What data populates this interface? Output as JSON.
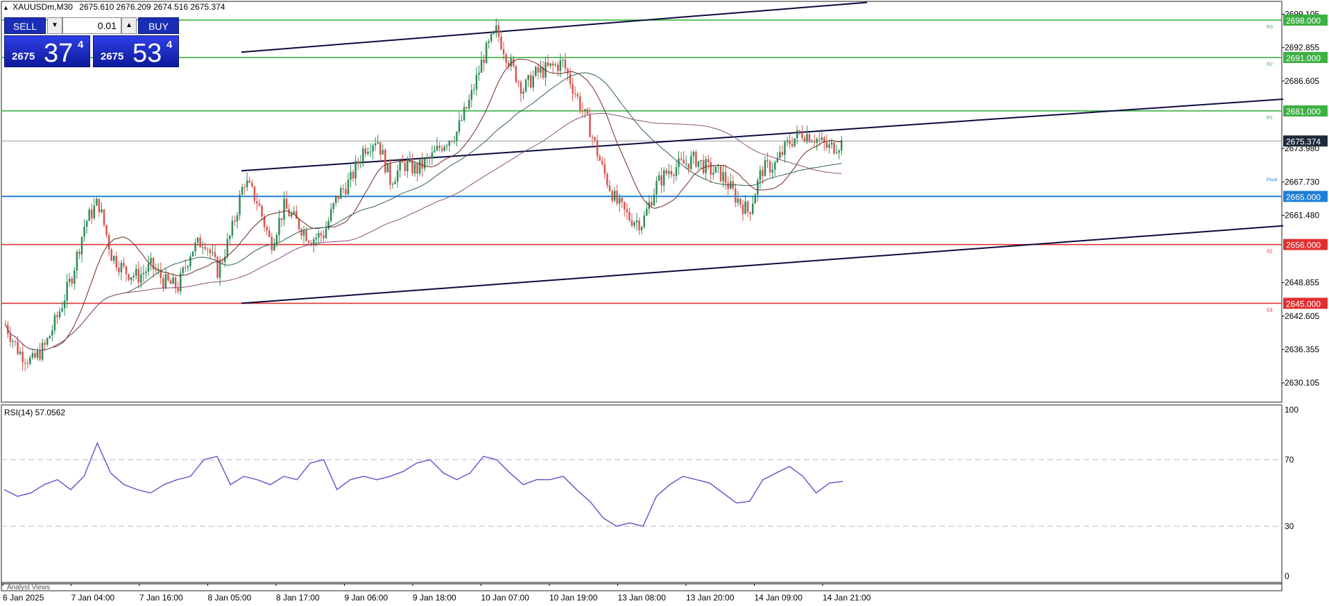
{
  "header": {
    "symbol": "XAUUSDm,M30",
    "ohlc": "2675.610 2676.209 2674.516 2675.374"
  },
  "trade_panel": {
    "sell_label": "SELL",
    "buy_label": "BUY",
    "lot": "0.01",
    "sell_price_small": "2675",
    "sell_price_big": "37",
    "sell_price_sup": "4",
    "buy_price_small": "2675",
    "buy_price_big": "53",
    "buy_price_sup": "4"
  },
  "colors": {
    "bull": "#2e8b57",
    "bear": "#d9534f",
    "resistance": "#3cb043",
    "support": "#e03030",
    "pivot": "#1e7fd8",
    "trendline": "#0a0a40",
    "rsi": "#6a5acd",
    "ma_fast": "#6b2a1a",
    "ma_mid": "#2f5f4f",
    "ma_slow": "#8b4d7a"
  },
  "chart_data": [
    {
      "type": "candlestick",
      "symbol": "XAUUSDm",
      "timeframe": "M30",
      "ylim": [
        2626.5,
        2701.5
      ],
      "yticks": [
        "2699.105",
        "2692.855",
        "2686.605",
        "2673.980",
        "2667.730",
        "2661.480",
        "2648.855",
        "2642.605",
        "2636.355",
        "2630.105"
      ],
      "current_price": "2675.374",
      "close_series": [
        2641,
        2636,
        2634,
        2637,
        2643,
        2650,
        2660,
        2664,
        2654,
        2651,
        2650,
        2652,
        2649,
        2648,
        2655,
        2657,
        2651,
        2658,
        2668,
        2664,
        2656,
        2663,
        2660,
        2657,
        2658,
        2665,
        2668,
        2674,
        2676,
        2668,
        2671,
        2670,
        2672,
        2675,
        2677,
        2683,
        2691,
        2696,
        2690,
        2685,
        2688,
        2689,
        2690,
        2684,
        2678,
        2670,
        2664,
        2661,
        2660,
        2667,
        2670,
        2671,
        2672,
        2670,
        2669,
        2665,
        2662,
        2670,
        2671,
        2675,
        2677,
        2676,
        2674,
        2675
      ],
      "levels": [
        {
          "label": "2698.000",
          "value": 2698.0,
          "tag": "R3",
          "kind": "resistance"
        },
        {
          "label": "2691.000",
          "value": 2691.0,
          "tag": "R2",
          "kind": "resistance"
        },
        {
          "label": "2681.000",
          "value": 2681.0,
          "tag": "R1",
          "kind": "resistance"
        },
        {
          "label": "2665.000",
          "value": 2665.0,
          "tag": "Pivot",
          "kind": "pivot"
        },
        {
          "label": "2656.000",
          "value": 2656.0,
          "tag": "S2",
          "kind": "support"
        },
        {
          "label": "2645.000",
          "value": 2645.0,
          "tag": "S3",
          "kind": "support"
        }
      ],
      "xticks": [
        "6 Jan 2025",
        "7 Jan 04:00",
        "7 Jan 16:00",
        "8 Jan 05:00",
        "8 Jan 17:00",
        "9 Jan 06:00",
        "9 Jan 18:00",
        "10 Jan 07:00",
        "10 Jan 19:00",
        "13 Jan 08:00",
        "13 Jan 20:00",
        "14 Jan 09:00",
        "14 Jan 21:00"
      ],
      "grid": false
    },
    {
      "type": "line",
      "indicator_label": "RSI(14) 57.0562",
      "ylim": [
        0,
        100
      ],
      "yticks": [
        "100",
        "70",
        "30",
        "0"
      ],
      "levels": [
        70,
        30
      ],
      "values": [
        52,
        48,
        50,
        55,
        58,
        52,
        60,
        80,
        62,
        55,
        52,
        50,
        55,
        58,
        60,
        70,
        72,
        55,
        60,
        58,
        55,
        60,
        58,
        68,
        70,
        52,
        58,
        60,
        58,
        60,
        63,
        68,
        70,
        62,
        58,
        62,
        72,
        70,
        62,
        55,
        58,
        58,
        60,
        52,
        45,
        35,
        30,
        32,
        30,
        48,
        55,
        60,
        58,
        56,
        50,
        44,
        45,
        58,
        62,
        66,
        60,
        50,
        56,
        57
      ]
    }
  ],
  "analyst_views_label": "Analyst Views"
}
